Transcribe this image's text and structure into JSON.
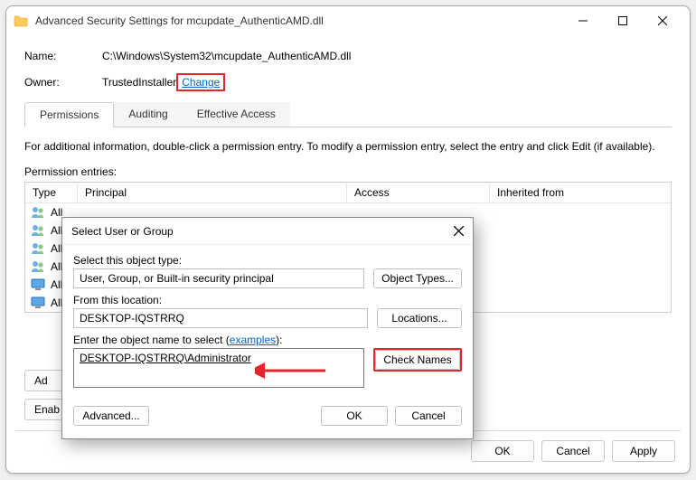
{
  "window": {
    "title": "Advanced Security Settings for mcupdate_AuthenticAMD.dll"
  },
  "info": {
    "name_label": "Name:",
    "name_value": "C:\\Windows\\System32\\mcupdate_AuthenticAMD.dll",
    "owner_label": "Owner:",
    "owner_value": "TrustedInstaller",
    "change_link": "Change"
  },
  "tabs": {
    "permissions": "Permissions",
    "auditing": "Auditing",
    "effective": "Effective Access"
  },
  "permissions": {
    "description": "For additional information, double-click a permission entry. To modify a permission entry, select the entry and click Edit (if available).",
    "entries_label": "Permission entries:",
    "columns": {
      "type": "Type",
      "principal": "Principal",
      "access": "Access",
      "inherited": "Inherited from"
    },
    "rows": [
      {
        "type": "All"
      },
      {
        "type": "All"
      },
      {
        "type": "All"
      },
      {
        "type": "All"
      },
      {
        "type": "All"
      },
      {
        "type": "All"
      }
    ]
  },
  "buttons": {
    "add": "Ad",
    "enable": "Enab",
    "ok": "OK",
    "cancel": "Cancel",
    "apply": "Apply"
  },
  "modal": {
    "title": "Select User or Group",
    "object_type_label": "Select this object type:",
    "object_type_value": "User, Group, or Built-in security principal",
    "object_types_btn": "Object Types...",
    "location_label": "From this location:",
    "location_value": "DESKTOP-IQSTRRQ",
    "locations_btn": "Locations...",
    "enter_label_prefix": "Enter the object name to select (",
    "examples_link": "examples",
    "enter_label_suffix": "):",
    "entered_value": "DESKTOP-IQSTRRQ\\Administrator",
    "check_names_btn": "Check Names",
    "advanced_btn": "Advanced...",
    "ok_btn": "OK",
    "cancel_btn": "Cancel"
  }
}
